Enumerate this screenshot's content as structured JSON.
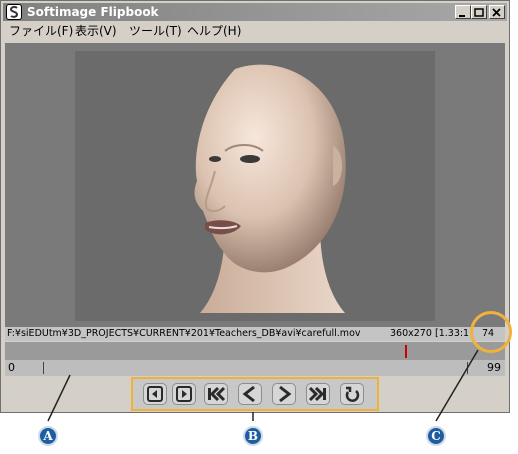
{
  "window": {
    "title": "Softimage Flipbook"
  },
  "menu": [
    {
      "label": "ファイル(F)"
    },
    {
      "label": "表示(V)"
    },
    {
      "label": "ツール(T)"
    },
    {
      "label": "ヘルプ(H)"
    }
  ],
  "info": {
    "path": "F:¥siEDUtm¥3D_PROJECTS¥CURRENT¥201¥Teachers_DB¥avi¥carefull.mov",
    "resolution": "360x270",
    "aspect": "[1.33:1",
    "frame": "74"
  },
  "playback": {
    "progress_fraction": 0.8
  },
  "range": {
    "start": "0",
    "end": "99"
  },
  "callouts": {
    "a": "A",
    "b": "B",
    "c": "C"
  },
  "colors": {
    "highlight": "#f1b23b",
    "callout": "#1f5da3",
    "marker": "#cc0000"
  },
  "controls": [
    {
      "name": "first-frame-icon"
    },
    {
      "name": "last-frame-icon"
    },
    {
      "name": "rewind-icon"
    },
    {
      "name": "play-backward-icon"
    },
    {
      "name": "play-forward-icon"
    },
    {
      "name": "fast-forward-icon"
    },
    {
      "name": "loop-icon"
    }
  ]
}
